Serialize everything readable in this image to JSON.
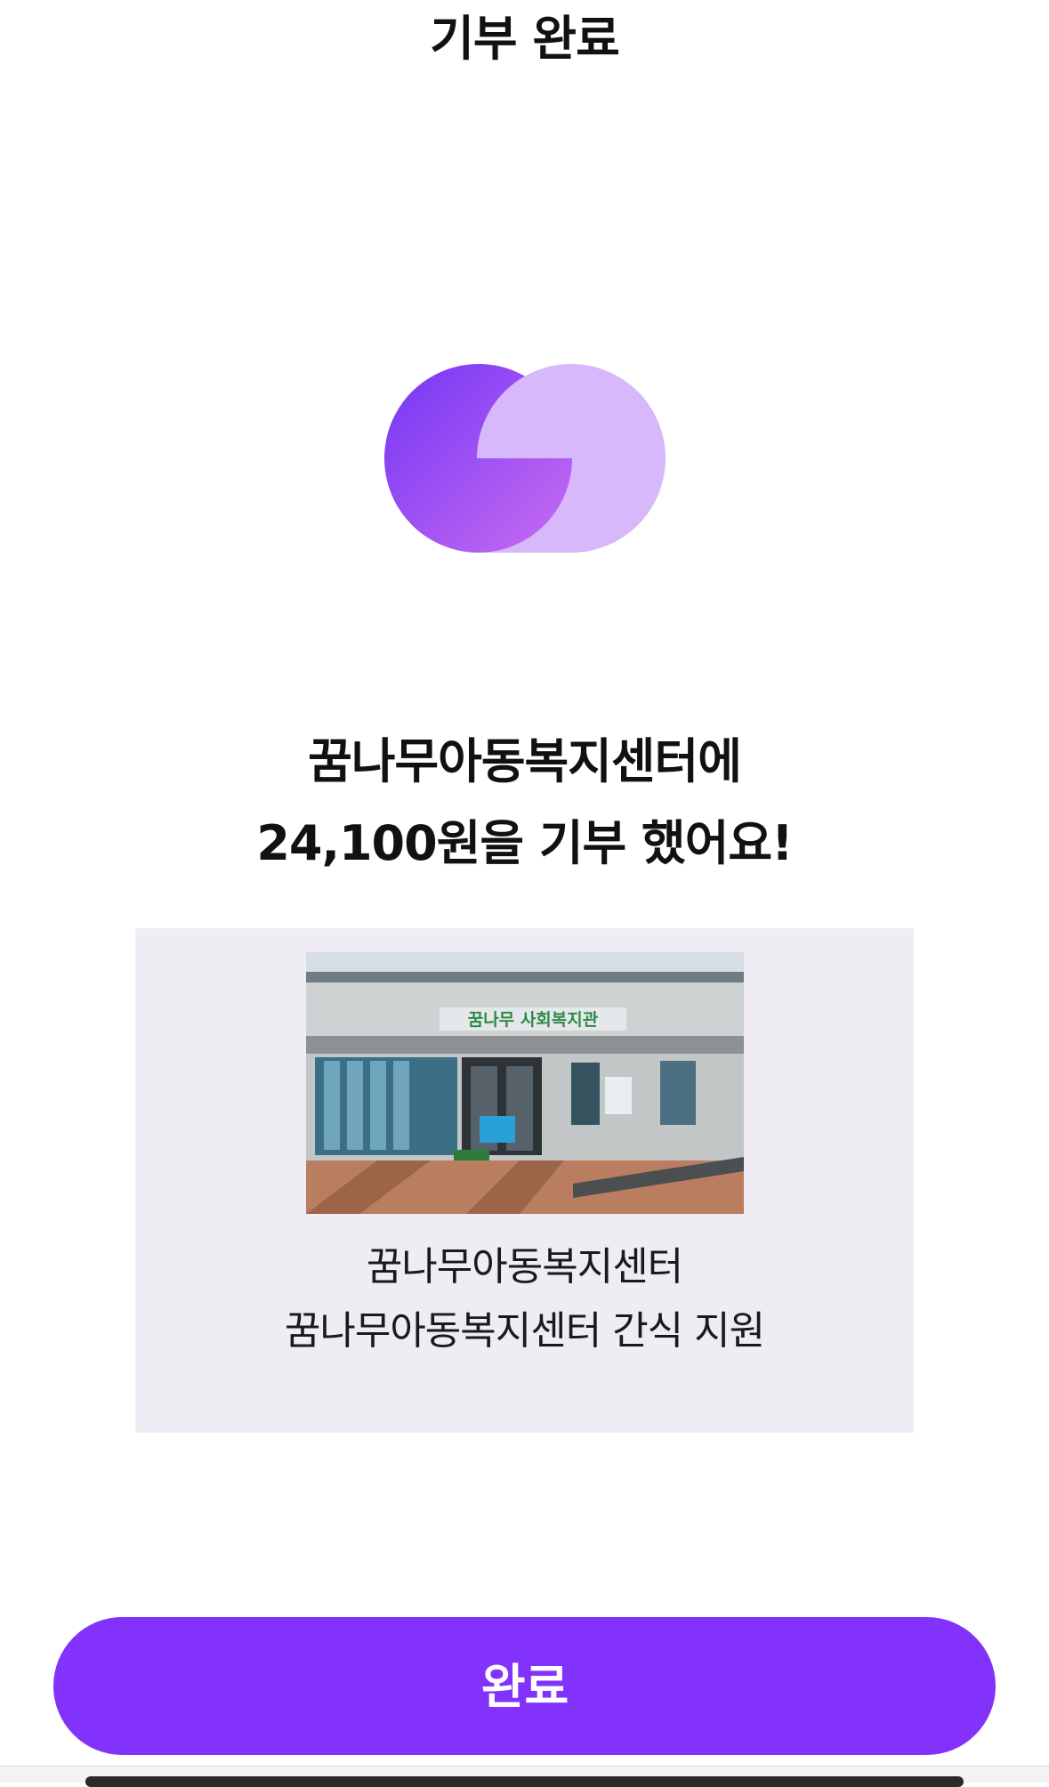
{
  "header": {
    "title": "기부 완료"
  },
  "logo": {
    "icon": "overlapping-circles-logo-icon",
    "colors": {
      "dark_start": "#7436f5",
      "dark_end": "#c96cf1",
      "light": "#d6b8fb"
    }
  },
  "message": {
    "line1": "꿈나무아동복지센터에",
    "line2": "24,100원을 기부 했어요!"
  },
  "card": {
    "photo": "community-welfare-center-building-photo",
    "sign_text": "꿈나무 사회복지관",
    "organization": "꿈나무아동복지센터",
    "project": "꿈나무아동복지센터 간식 지원"
  },
  "footer": {
    "complete_label": "완료"
  },
  "colors": {
    "accent": "#8232fa",
    "card_background": "#efedf3"
  }
}
